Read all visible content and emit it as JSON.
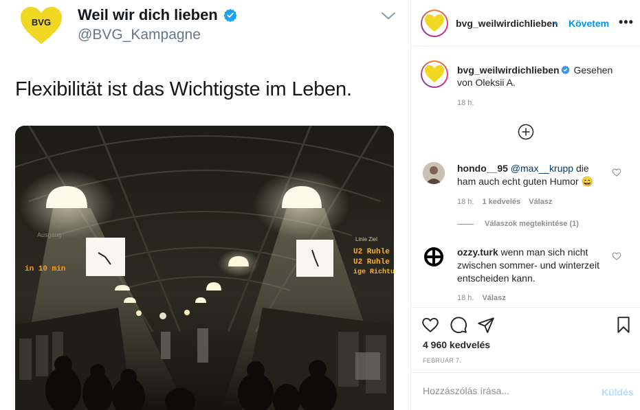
{
  "tweet": {
    "logo_text": "BVG",
    "display_name": "Weil wir dich lieben",
    "handle": "@BVG_Kampagne",
    "text": "Flexibilität ist das Wichtigste im Leben.",
    "photo": {
      "display_left": "in 10 min",
      "display_right_line1": "U2  Ruhle",
      "display_right_line2": "U2  Ruhle",
      "display_right_line3": "ige Richtung",
      "display_right_header": "Linie    Ziel",
      "sign_left": "Ausgang"
    }
  },
  "post": {
    "username": "bvg_weilwirdichlieben",
    "follow_label": "Követem",
    "more_label": "•••",
    "caption": {
      "username": "bvg_weilwirdichlieben",
      "text": "Gesehen von Oleksii A.",
      "time": "18 h."
    },
    "comments": [
      {
        "username": "hondo__95",
        "mention": "@max__krupp",
        "text": "die ham auch echt guten Humor 😄",
        "time": "18 h.",
        "likes": "1 kedvelés",
        "reply": "Válasz",
        "view_replies": "Válaszok megtekintése (1)"
      },
      {
        "username": "ozzy.turk",
        "text": "wenn man sich nicht zwischen sommer- und winterzeit entscheiden kann.",
        "time": "18 h.",
        "reply": "Válasz"
      }
    ],
    "likes": "4 960 kedvelés",
    "date": "FEBRUÁR 7.",
    "comment_placeholder": "Hozzászólás írása...",
    "post_label": "Küldés"
  },
  "colors": {
    "bvg_yellow": "#f0d722",
    "link_blue": "#0095f6",
    "verified_blue": "#3897f0",
    "muted": "#8e8e8e"
  }
}
